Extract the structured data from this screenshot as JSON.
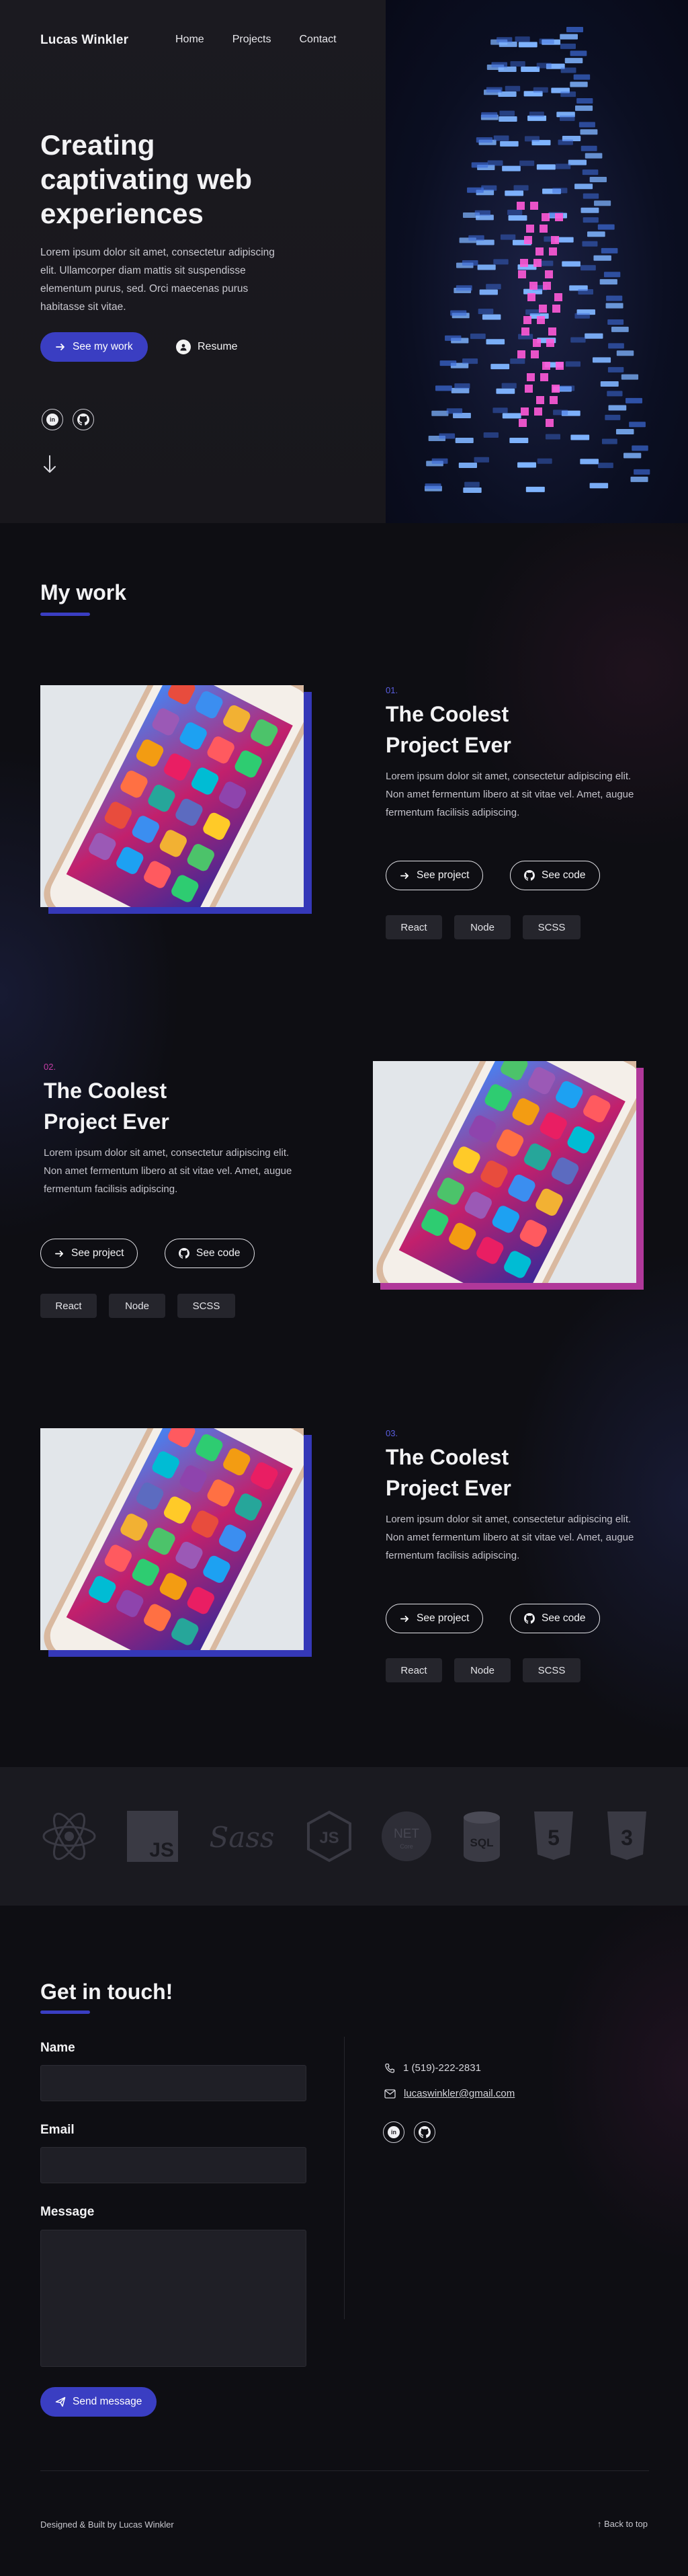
{
  "header": {
    "logo": "Lucas Winkler",
    "nav": [
      "Home",
      "Projects",
      "Contact"
    ]
  },
  "hero": {
    "title": "Creating captivating web experiences",
    "subtitle": "Lorem ipsum dolor sit amet, consectetur adipiscing elit. Ullamcorper diam mattis sit suspendisse elementum purus, sed. Orci maecenas purus habitasse sit vitae.",
    "cta_label": "See my work",
    "resume_label": "Resume",
    "social": [
      "linkedin-icon",
      "github-icon"
    ]
  },
  "work": {
    "title": "My work",
    "projects": [
      {
        "num": "01.",
        "title": "The Coolest Project Ever",
        "desc": "Lorem ipsum dolor sit amet, consectetur adipiscing elit. Non amet fermentum libero at sit vitae vel. Amet, augue fermentum facilisis adipiscing.",
        "see_project": "See project",
        "see_code": "See code",
        "tags": [
          "React",
          "Node",
          "SCSS"
        ],
        "num_color": "#5a5ee0",
        "shadow_color": "#3538b8"
      },
      {
        "num": "02.",
        "title": "The Coolest Project Ever",
        "desc": "Lorem ipsum dolor sit amet, consectetur adipiscing elit. Non amet fermentum libero at sit vitae vel. Amet, augue fermentum facilisis adipiscing.",
        "see_project": "See project",
        "see_code": "See code",
        "tags": [
          "React",
          "Node",
          "SCSS"
        ],
        "num_color": "#c53ea6",
        "shadow_color": "#b0389a"
      },
      {
        "num": "03.",
        "title": "The Coolest Project Ever",
        "desc": "Lorem ipsum dolor sit amet, consectetur adipiscing elit. Non amet fermentum libero at sit vitae vel. Amet, augue fermentum facilisis adipiscing.",
        "see_project": "See project",
        "see_code": "See code",
        "tags": [
          "React",
          "Node",
          "SCSS"
        ],
        "num_color": "#5a5ee0",
        "shadow_color": "#3538b8"
      }
    ]
  },
  "tech": {
    "icons": [
      "react-icon",
      "javascript-icon",
      "sass-icon",
      "nodejs-icon",
      "dotnet-icon",
      "sql-icon",
      "html5-icon",
      "css3-icon"
    ],
    "js_text": "JS",
    "sass_text": "Sass",
    "net_text": "NET",
    "net_sub": "Core",
    "sql_text": "SQL",
    "html_num": "5",
    "css_num": "3"
  },
  "contact": {
    "title": "Get in touch!",
    "name_label": "Name",
    "email_label": "Email",
    "message_label": "Message",
    "name_value": "",
    "email_value": "",
    "message_value": "",
    "send_label": "Send message",
    "phone": "1 (519)-222-2831",
    "email": "lucaswinkler@gmail.com"
  },
  "footer": {
    "credit": "Designed & Built by Lucas Winkler",
    "back_to_top": "Back to top"
  },
  "colors": {
    "accent": "#3a3ec2",
    "pink": "#b0389a",
    "background": "#0e0e13"
  }
}
